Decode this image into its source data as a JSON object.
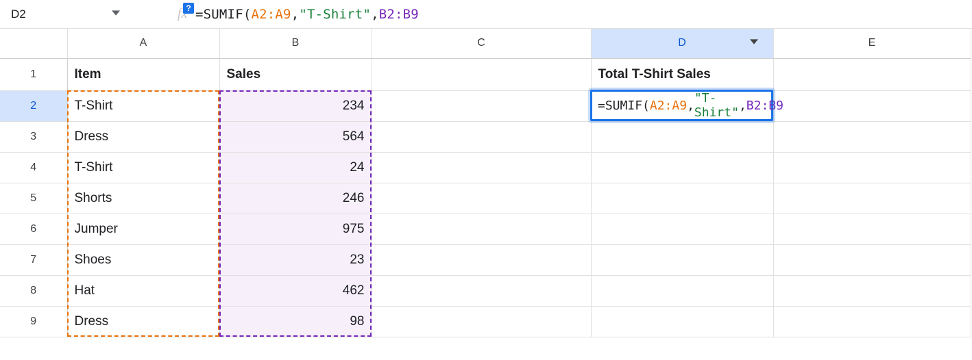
{
  "name_box": "D2",
  "help_badge": "?",
  "formula": {
    "eq": "=",
    "fn": "SUMIF",
    "open": "(",
    "range1": "A2:A9",
    "sep1": ",",
    "str": "\"T-Shirt\"",
    "sep2": ",",
    "range2": "B2:B9",
    "close": ""
  },
  "columns": [
    "A",
    "B",
    "C",
    "D",
    "E"
  ],
  "rows": [
    "1",
    "2",
    "3",
    "4",
    "5",
    "6",
    "7",
    "8",
    "9"
  ],
  "cells": {
    "A1": "Item",
    "B1": "Sales",
    "D1": "Total T-Shirt Sales",
    "A2": "T-Shirt",
    "B2": "234",
    "A3": "Dress",
    "B3": "564",
    "A4": "T-Shirt",
    "B4": "24",
    "A5": "Shorts",
    "B5": "246",
    "A6": "Jumper",
    "B6": "975",
    "A7": "Shoes",
    "B7": "23",
    "A8": "Hat",
    "B8": "462",
    "A9": "Dress",
    "B9": "98"
  },
  "active_cell": {
    "formula_eq": "=",
    "formula_fn": "SUMIF",
    "formula_open": "(",
    "formula_r1": "A2:A9",
    "formula_s1": ",",
    "formula_str": "\"T-Shirt\"",
    "formula_s2": ",",
    "formula_r2": "B2:B9"
  }
}
